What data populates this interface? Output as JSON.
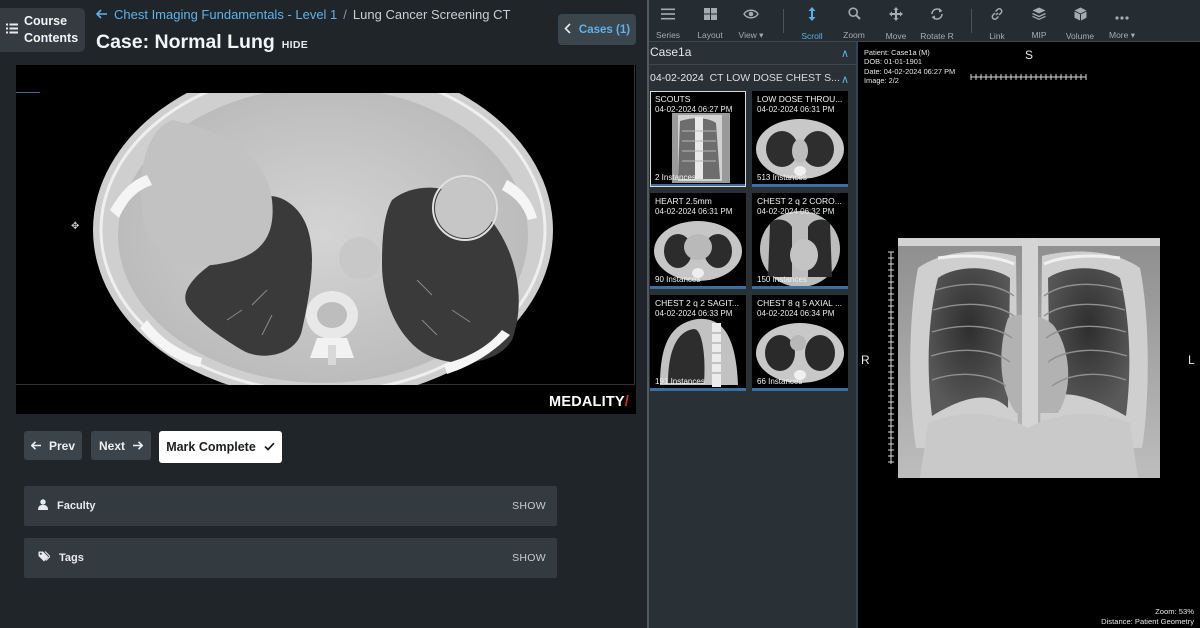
{
  "course": {
    "label": "Course\nContents"
  },
  "breadcrumb": {
    "link": "Chest Imaging Fundamentals - Level 1",
    "separator": "/",
    "current": "Lung Cancer Screening CT"
  },
  "case": {
    "title": "Case: Normal Lung",
    "hide_label": "HIDE"
  },
  "cases_button": {
    "label": "Cases (1)"
  },
  "watermark": {
    "brand": "MEDALITY",
    "slash": "/"
  },
  "nav": {
    "prev": "Prev",
    "next": "Next",
    "mark_complete": "Mark Complete"
  },
  "panels": [
    {
      "label": "Faculty",
      "action": "SHOW",
      "icon": "user-icon"
    },
    {
      "label": "Tags",
      "action": "SHOW",
      "icon": "tag-icon"
    }
  ],
  "toolbar": {
    "tools": [
      {
        "label": "Series",
        "icon": "menu-icon"
      },
      {
        "label": "Layout",
        "icon": "layout-grid-icon"
      },
      {
        "label": "View ▾",
        "icon": "eye-icon"
      },
      {
        "label": "Scroll",
        "icon": "scroll-arrows-icon",
        "active": true
      },
      {
        "label": "Zoom",
        "icon": "zoom-icon"
      },
      {
        "label": "Move",
        "icon": "move-icon"
      },
      {
        "label": "Rotate R",
        "icon": "rotate-icon"
      },
      {
        "label": "Link",
        "icon": "link-icon"
      },
      {
        "label": "MIP",
        "icon": "layers-icon"
      },
      {
        "label": "Volume",
        "icon": "cube-icon"
      },
      {
        "label": "More ▾",
        "icon": "more-dots-icon"
      }
    ]
  },
  "series_panel": {
    "case_name": "Case1a",
    "study_date": "04-02-2024",
    "study_desc": "CT LOW DOSE CHEST S...",
    "series": [
      {
        "name": "SCOUTS",
        "datetime": "04-02-2024 06:27 PM",
        "count": "2 Instances",
        "kind": "scout",
        "selected": true
      },
      {
        "name": "LOW DOSE THROU...",
        "datetime": "04-02-2024 06:31 PM",
        "count": "513 Instances",
        "kind": "axial"
      },
      {
        "name": "HEART 2.5mm",
        "datetime": "04-02-2024 06:31 PM",
        "count": "90 Instances",
        "kind": "axial"
      },
      {
        "name": "CHEST 2 q 2 CORO...",
        "datetime": "04-02-2024 06:32 PM",
        "count": "150 Instances",
        "kind": "coronal"
      },
      {
        "name": "CHEST 2 q 2 SAGIT...",
        "datetime": "04-02-2024 06:33 PM",
        "count": "191 Instances",
        "kind": "sagittal"
      },
      {
        "name": "CHEST 8 q 5 AXIAL ...",
        "datetime": "04-02-2024 06:34 PM",
        "count": "66 Instances",
        "kind": "axial"
      }
    ]
  },
  "image_viewer": {
    "patient": "Patient: Case1a (M)",
    "dob": "DOB: 01-01-1901",
    "date": "Date: 04-02-2024 06:27 PM",
    "image": "Image: 2/2",
    "orient_top": "S",
    "orient_left": "R",
    "orient_right": "L",
    "zoom": "Zoom: 53%",
    "distance": "Distance: Patient Geometry"
  }
}
